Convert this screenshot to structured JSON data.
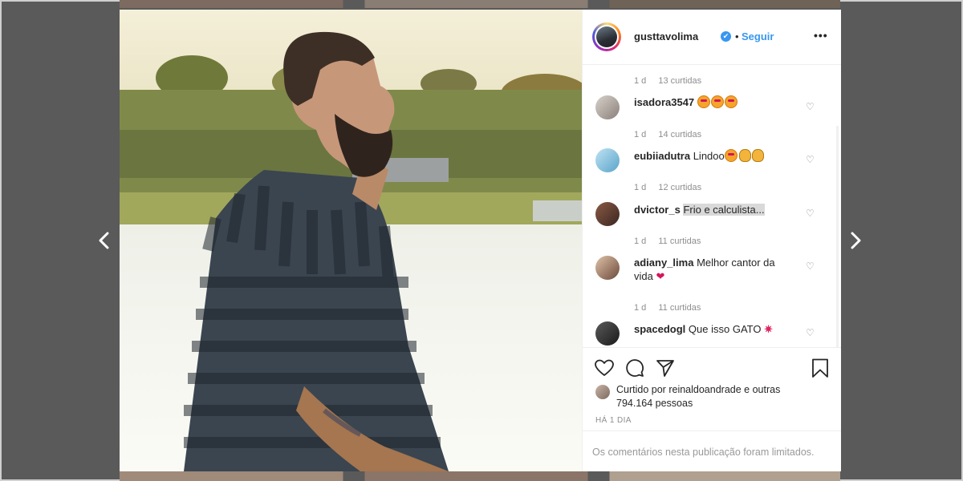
{
  "post": {
    "username": "gusttavolima",
    "verified_mark": "✔",
    "separator": "•",
    "follow_label": "Seguir",
    "more_label": "•••"
  },
  "comments": [
    {
      "user": "",
      "text": "",
      "time": "1 d",
      "likes": "13 curtidas"
    },
    {
      "user": "isadora3547",
      "text": "",
      "time": "1 d",
      "likes": "14 curtidas"
    },
    {
      "user": "eubiiadutra",
      "text": "Lindoo",
      "time": "1 d",
      "likes": "12 curtidas"
    },
    {
      "user": "dvictor_s",
      "text": "Frio e calculista...",
      "time": "1 d",
      "likes": "11 curtidas"
    },
    {
      "user": "adiany_lima",
      "text": "Melhor cantor da vida",
      "time": "1 d",
      "likes": "11 curtidas"
    },
    {
      "user": "spacedogl",
      "text": "Que isso GATO",
      "time": "",
      "likes": ""
    }
  ],
  "likes_summary": {
    "prefix": "Curtido por",
    "user": "reinaldoandrade",
    "connector": "e",
    "others": "outras 794.164 pessoas"
  },
  "post_date": "HÁ 1 DIA",
  "comments_limited": "Os comentários nesta publicação foram limitados.",
  "icons": {
    "prev": "chevron-left-icon",
    "next": "chevron-right-icon",
    "like": "heart-icon",
    "comment": "comment-bubble-icon",
    "share": "paper-plane-icon",
    "save": "bookmark-icon"
  },
  "colors": {
    "link": "#3897f0",
    "text": "#262626",
    "muted": "#8e8e8e"
  }
}
